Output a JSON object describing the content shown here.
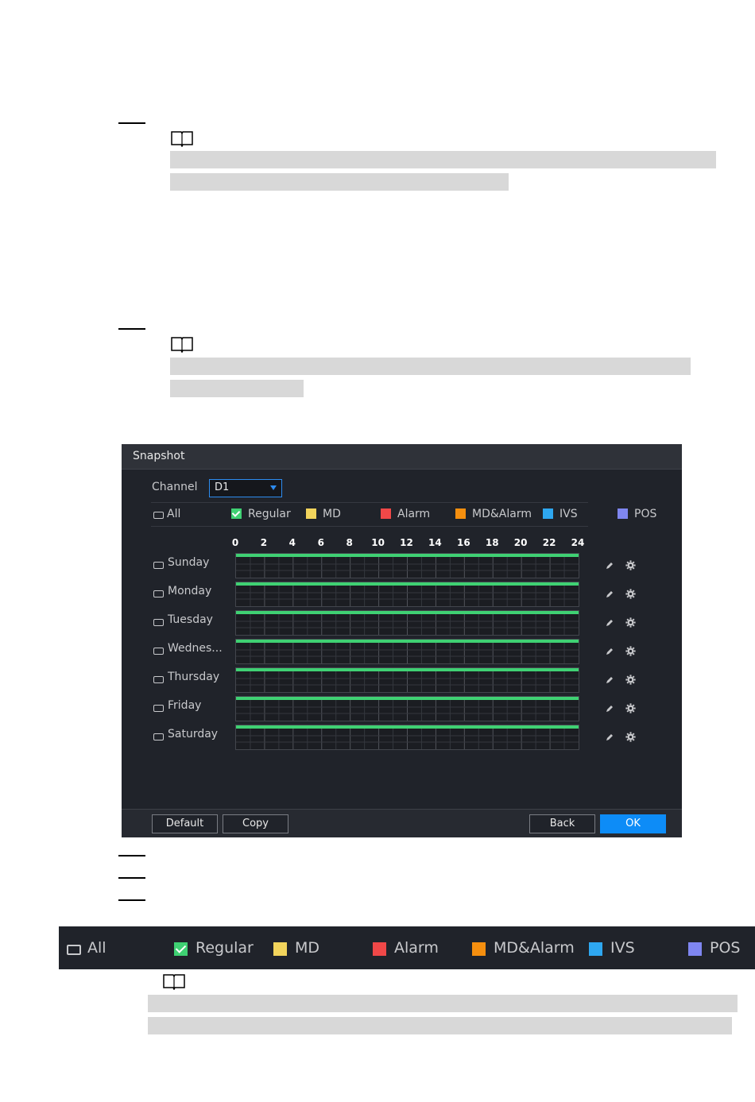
{
  "window": {
    "title": "Snapshot",
    "channel_label": "Channel",
    "channel_value": "D1",
    "all_label": "All",
    "legend": [
      {
        "label": "Regular",
        "color": "#3fd173",
        "checked": true
      },
      {
        "label": "MD",
        "color": "#f2d45c",
        "checked": false
      },
      {
        "label": "Alarm",
        "color": "#f04848",
        "checked": false
      },
      {
        "label": "MD&Alarm",
        "color": "#f58f0f",
        "checked": false
      },
      {
        "label": "IVS",
        "color": "#2ea7f0",
        "checked": false
      },
      {
        "label": "POS",
        "color": "#7f86f0",
        "checked": false
      }
    ],
    "hour_ticks": [
      "0",
      "2",
      "4",
      "6",
      "8",
      "10",
      "12",
      "14",
      "16",
      "18",
      "20",
      "22",
      "24"
    ],
    "days": [
      "Sunday",
      "Monday",
      "Tuesday",
      "Wednes...",
      "Thursday",
      "Friday",
      "Saturday"
    ],
    "buttons": {
      "default": "Default",
      "copy": "Copy",
      "back": "Back",
      "ok": "OK"
    }
  },
  "legend_strip": {
    "all_label": "All",
    "items": [
      {
        "label": "Regular",
        "color": "#3fd173",
        "checked": true
      },
      {
        "label": "MD",
        "color": "#f2d45c",
        "checked": false
      },
      {
        "label": "Alarm",
        "color": "#f04848",
        "checked": false
      },
      {
        "label": "MD&Alarm",
        "color": "#f58f0f",
        "checked": false
      },
      {
        "label": "IVS",
        "color": "#2ea7f0",
        "checked": false
      },
      {
        "label": "POS",
        "color": "#7f86f0",
        "checked": false
      }
    ]
  }
}
